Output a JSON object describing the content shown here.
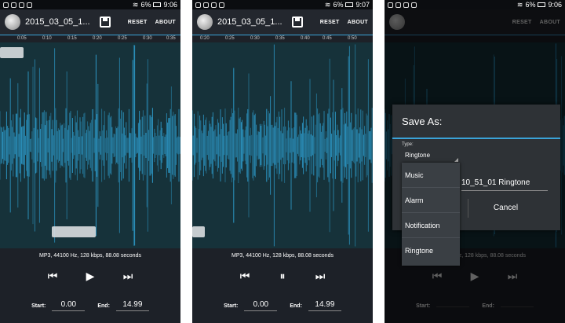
{
  "status": {
    "battery_levels": [
      "6%",
      "6%",
      "6%"
    ],
    "times": [
      "9:06",
      "9:07",
      "9:06"
    ]
  },
  "actionbar": {
    "file_title": "2015_03_05_1...",
    "reset_label": "RESET",
    "about_label": "ABOUT"
  },
  "screens": [
    {
      "ticks": [
        "0:05",
        "0:10",
        "0:15",
        "0:20",
        "0:25",
        "0:30",
        "0:35"
      ]
    },
    {
      "ticks": [
        "0:20",
        "0:25",
        "0:30",
        "0:35",
        "0:40",
        "0:45",
        "0:50"
      ]
    },
    {
      "ticks": []
    }
  ],
  "info_text": "MP3, 44100 Hz, 128 kbps, 88.08 seconds",
  "transport": {
    "prev": "⏮",
    "play": "▶",
    "pause": "⏸",
    "next": "⏭"
  },
  "times": {
    "start_label": "Start:",
    "start_value": "0.00",
    "end_label": "End:",
    "end_value": "14.99"
  },
  "dialog": {
    "title": "Save As:",
    "type_label": "Type:",
    "type_value": "Ringtone",
    "name_value": "10_51_01 Ringtone",
    "cancel_label": "Cancel",
    "options": [
      "Music",
      "Alarm",
      "Notification",
      "Ringtone"
    ]
  },
  "colors": {
    "accent": "#3aa3d8",
    "wave": "#2e9fd0",
    "wave_bg": "#16323a"
  }
}
